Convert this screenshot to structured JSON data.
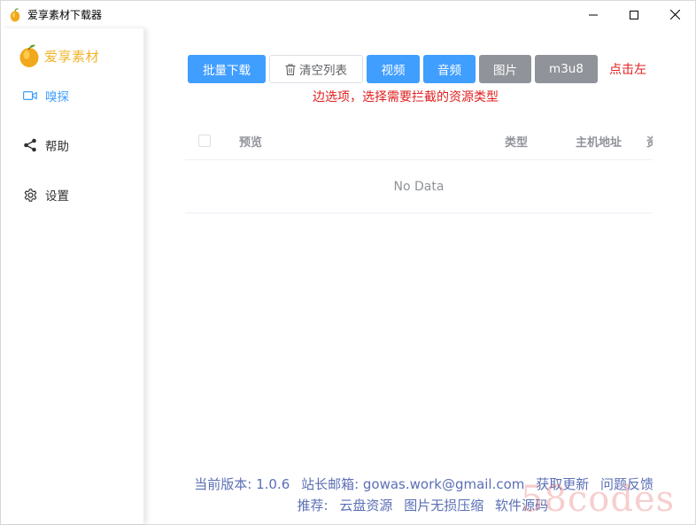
{
  "window": {
    "title": "爱享素材下载器",
    "controls": [
      "minimize-icon",
      "maximize-icon",
      "close-icon"
    ]
  },
  "sidebar": {
    "brand": "爱享素材",
    "items": [
      {
        "label": "嗅探",
        "icon": "video-camera-icon",
        "active": true
      },
      {
        "label": "帮助",
        "icon": "share-icon",
        "active": false
      },
      {
        "label": "设置",
        "icon": "gear-icon",
        "active": false
      }
    ]
  },
  "toolbar": {
    "batch_download": "批量下载",
    "clear_list": "清空列表",
    "video": "视频",
    "audio": "音频",
    "image": "图片",
    "m3u8": "m3u8"
  },
  "hint": {
    "line1": "点击左",
    "line2": "边选项，选择需要拦截的资源类型"
  },
  "table": {
    "columns": [
      "预览",
      "类型",
      "主机地址",
      "资"
    ],
    "empty_text": "No Data"
  },
  "footer": {
    "version": "当前版本: 1.0.6",
    "email": "站长邮箱: gowas.work@gmail.com",
    "update": "获取更新",
    "feedback": "问题反馈",
    "recommend_label": "推荐:",
    "links": [
      "云盘资源",
      "图片无损压缩",
      "软件源码"
    ]
  },
  "watermark": "58codes",
  "colors": {
    "primary": "#409eff",
    "info": "#909399",
    "brand": "#f0b429",
    "hint": "#e02020",
    "footer_link": "#5b6fb5"
  }
}
